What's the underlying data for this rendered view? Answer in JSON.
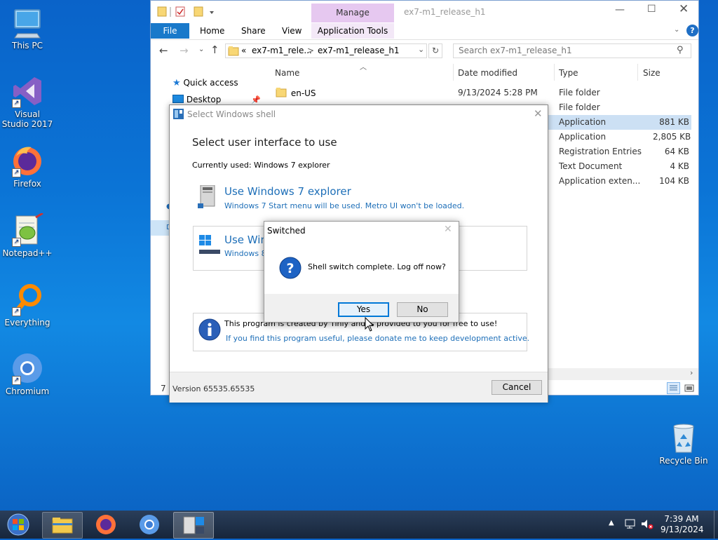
{
  "desktop": {
    "icons": [
      {
        "label": "This PC",
        "icon": "this-pc-icon"
      },
      {
        "label": "Visual Studio 2017",
        "icon": "visual-studio-icon"
      },
      {
        "label": "Firefox",
        "icon": "firefox-icon"
      },
      {
        "label": "Notepad++",
        "icon": "notepadpp-icon"
      },
      {
        "label": "Everything",
        "icon": "everything-icon"
      },
      {
        "label": "Chromium",
        "icon": "chromium-icon"
      },
      {
        "label": "Recycle Bin",
        "icon": "recycle-bin-icon"
      }
    ]
  },
  "explorer": {
    "context_tab": "Manage",
    "window_title": "ex7-m1_release_h1",
    "tabs": [
      "File",
      "Home",
      "Share",
      "View",
      "Application Tools"
    ],
    "address": {
      "prefix": "«",
      "crumb1": "ex7-m1_rele...",
      "sep": ">",
      "crumb2": "ex7-m1_release_h1"
    },
    "search_placeholder": "Search ex7-m1_release_h1",
    "nav": {
      "quick_access": "Quick access",
      "desktop": "Desktop"
    },
    "columns": {
      "name": "Name",
      "date": "Date modified",
      "type": "Type",
      "size": "Size"
    },
    "rows": [
      {
        "name": "en-US",
        "date": "9/13/2024 5:28 PM",
        "type": "File folder",
        "size": ""
      },
      {
        "name": "",
        "date": "",
        "type": "File folder",
        "size": ""
      },
      {
        "name": "",
        "date": "",
        "type": "Application",
        "size": "881 KB"
      },
      {
        "name": "",
        "date": "",
        "type": "Application",
        "size": "2,805 KB"
      },
      {
        "name": "",
        "date": "",
        "type": "Registration Entries",
        "size": "64 KB"
      },
      {
        "name": "",
        "date": "",
        "type": "Text Document",
        "size": "4 KB"
      },
      {
        "name": "",
        "date": "",
        "type": "Application exten...",
        "size": "104 KB"
      }
    ],
    "status_prefix": "7 it"
  },
  "shell_dialog": {
    "title": "Select Windows shell",
    "heading": "Select user interface to use",
    "current": "Currently used: Windows 7 explorer",
    "option1_title": "Use Windows 7 explorer",
    "option1_desc": "Windows 7 Start menu will be used. Metro UI won't be loaded.",
    "option2_title": "Use Win",
    "option2_desc": "Windows 8",
    "info_text": "This program is created by Tihiy and is provided to you for free to use!",
    "info_link": "If you find this program useful, please donate me to keep development active.",
    "version": "Version 65535.65535",
    "cancel": "Cancel"
  },
  "message_box": {
    "title": "Switched",
    "message": "Shell switch complete. Log off now?",
    "yes": "Yes",
    "no": "No"
  },
  "taskbar": {
    "time": "7:39 AM",
    "date": "9/13/2024"
  },
  "colors": {
    "accent": "#0078d7",
    "link": "#1e6fb8",
    "manage_tab": "#e6c8f0",
    "selected_row": "#cce0f4"
  }
}
